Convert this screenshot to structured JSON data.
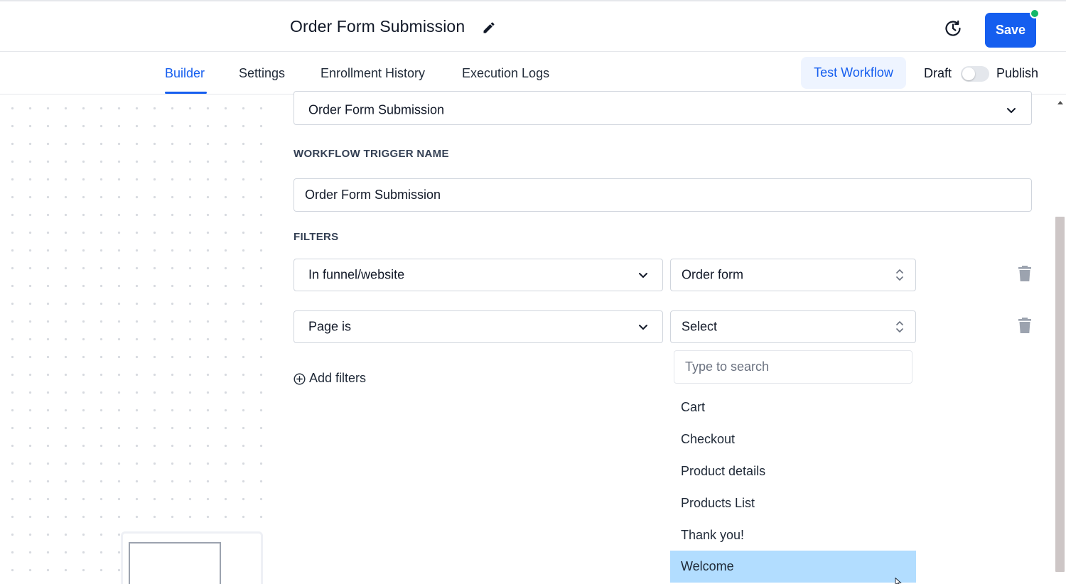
{
  "header": {
    "title": "Order Form Submission",
    "edit_icon": "pencil-icon",
    "history_icon": "history-clock-icon",
    "save_label": "Save",
    "status_color": "#12b76a",
    "accent_color": "#155eef"
  },
  "tabs": {
    "items": [
      {
        "label": "Builder",
        "active": true
      },
      {
        "label": "Settings",
        "active": false
      },
      {
        "label": "Enrollment History",
        "active": false
      },
      {
        "label": "Execution Logs",
        "active": false
      }
    ],
    "test_workflow_label": "Test Workflow",
    "draft_label": "Draft",
    "publish_label": "Publish",
    "publish_toggle_on": false
  },
  "form": {
    "trigger_select": {
      "value": "Order Form Submission"
    },
    "trigger_name_label": "WORKFLOW TRIGGER NAME",
    "trigger_name_value": "Order Form Submission",
    "filters_label": "FILTERS",
    "filters": [
      {
        "field": "In funnel/website",
        "value": "Order form"
      },
      {
        "field": "Page is",
        "value": "Select"
      }
    ],
    "add_filters_label": "Add filters"
  },
  "dropdown": {
    "search_placeholder": "Type to search",
    "options": [
      "Cart",
      "Checkout",
      "Product details",
      "Products List",
      "Thank you!",
      "Welcome"
    ],
    "highlighted": "Welcome",
    "highlight_color": "#b2ddff"
  }
}
